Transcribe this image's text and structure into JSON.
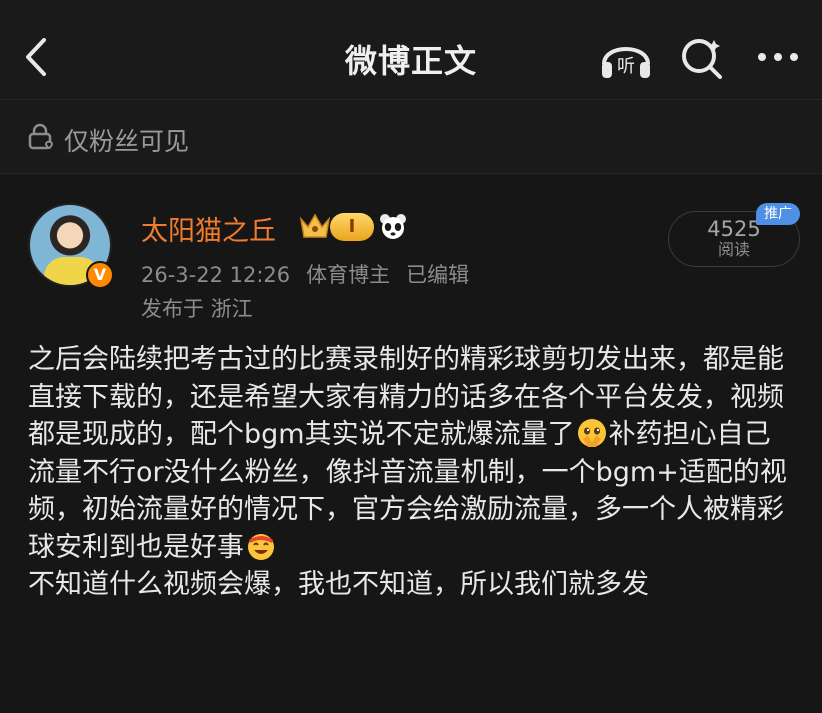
{
  "header": {
    "title": "微博正文",
    "listen_label": "听"
  },
  "visibility": {
    "label": "仅粉丝可见"
  },
  "post": {
    "author": {
      "name": "太阳猫之丘",
      "level_badge": "I",
      "verified_mark": "V"
    },
    "meta": {
      "datetime": "26-3-22 12:26",
      "role": "体育博主",
      "edited": "已编辑"
    },
    "location": "发布于 浙江",
    "read_count": {
      "value": "4525",
      "label": "阅读",
      "promo": "推广"
    },
    "text_parts": [
      "之后会陆续把考古过的比赛录制好的精彩球剪切发出来，都是能直接下载的，还是希望大家有精力的话多在各个平台发发，视频都是现成的，配个bgm其实说不定就爆流量了",
      "补药担心自己流量不行or没什么粉丝，像抖音流量机制，一个bgm+适配的视频，初始流量好的情况下，官方会给激励流量，多一个人被精彩球安利到也是好事",
      "\n不知道什么视频会爆，我也不知道，所以我们就多发"
    ],
    "emojis": [
      "pleading-face-emoji",
      "grinning-face-emoji"
    ]
  },
  "colors": {
    "username": "#f07c2c",
    "promo_badge": "#4f8fe6",
    "verified_badge": "#ff8a00",
    "background": "#161616"
  }
}
